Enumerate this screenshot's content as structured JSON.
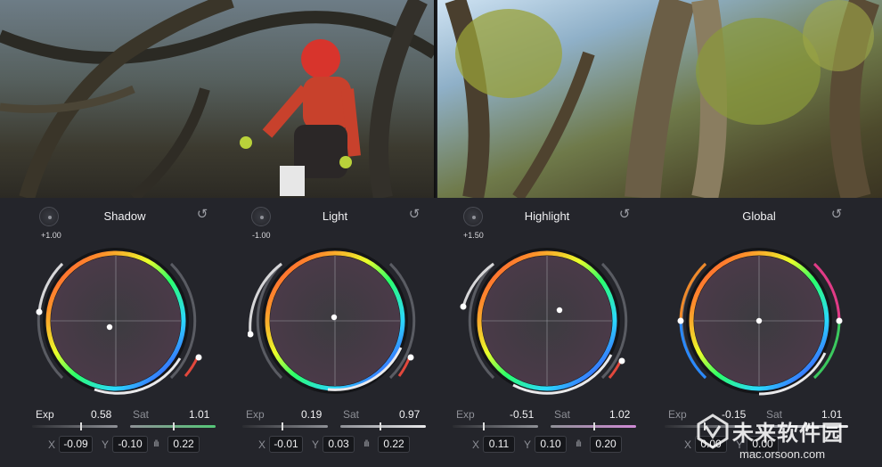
{
  "colors": {
    "panel_bg": "#24252b",
    "wheel_center": "#ffffff",
    "accent_red": "#e2483c"
  },
  "wheels": [
    {
      "id": "shadow",
      "title": "Shadow",
      "dial_value": "+1.00",
      "exp_label": "Exp",
      "exp_value": "0.58",
      "sat_label": "Sat",
      "sat_value": "1.01",
      "x_label": "X",
      "x_value": "-0.09",
      "y_label": "Y",
      "y_value": "-0.10",
      "lum_value": "0.22",
      "point": [
        -0.09,
        -0.1
      ]
    },
    {
      "id": "light",
      "title": "Light",
      "dial_value": "-1.00",
      "exp_label": "Exp",
      "exp_value": "0.19",
      "sat_label": "Sat",
      "sat_value": "0.97",
      "x_label": "X",
      "x_value": "-0.01",
      "y_label": "Y",
      "y_value": "0.03",
      "lum_value": "0.22",
      "point": [
        -0.01,
        0.03
      ]
    },
    {
      "id": "highlight",
      "title": "Highlight",
      "dial_value": "+1.50",
      "exp_label": "Exp",
      "exp_value": "-0.51",
      "sat_label": "Sat",
      "sat_value": "1.02",
      "x_label": "X",
      "x_value": "0.11",
      "y_label": "Y",
      "y_value": "0.10",
      "lum_value": "0.20",
      "point": [
        0.11,
        0.1
      ]
    },
    {
      "id": "global",
      "title": "Global",
      "dial_value": "",
      "exp_label": "Exp",
      "exp_value": "-0.15",
      "sat_label": "Sat",
      "sat_value": "1.01",
      "x_label": "X",
      "x_value": "0.00",
      "y_label": "Y",
      "y_value": "0.00",
      "lum_value": "",
      "point": [
        0.0,
        0.0
      ]
    }
  ],
  "watermark": {
    "text": "未来软件园",
    "url": "mac.orsoon.com"
  }
}
